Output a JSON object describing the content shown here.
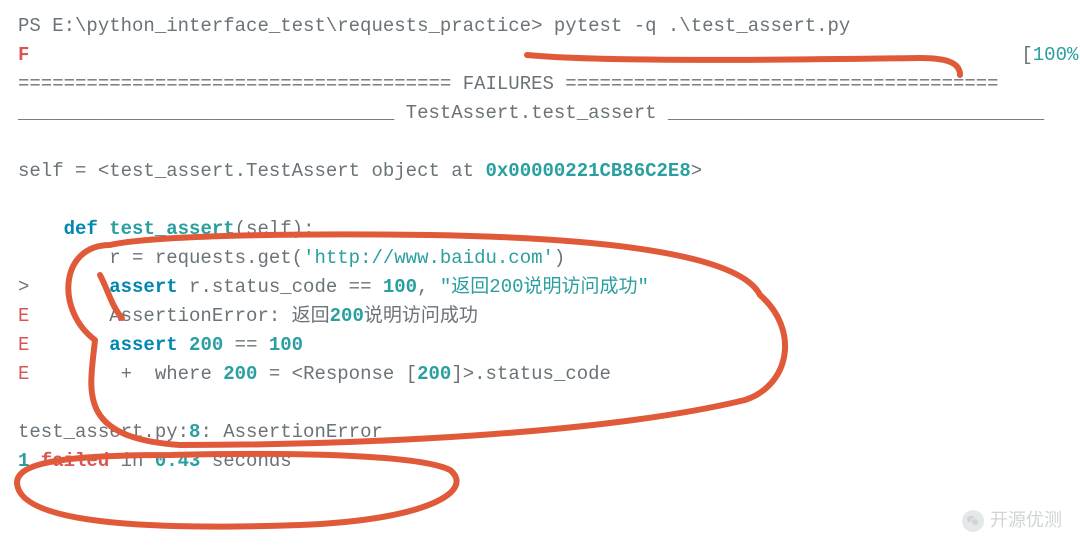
{
  "line1": {
    "prompt": "PS E:\\python_interface_test\\requests_practice> ",
    "cmd": "pytest -q .\\test_assert.py"
  },
  "line2": {
    "fail": "F",
    "pct_open": "[",
    "pct_val": "100%",
    "pct_close": "]"
  },
  "line3": {
    "eq_left": "====================================== ",
    "failures": "FAILURES",
    "eq_right": " ======================================"
  },
  "line4": {
    "u_left": "_________________________________ ",
    "tname": "TestAssert.test_assert",
    "u_right": " _________________________________"
  },
  "blank1": " ",
  "line5": {
    "pre": "self = <test_assert.TestAssert object at ",
    "hex": "0x00000221CB86C2E8",
    "post": ">"
  },
  "blank2": " ",
  "line6": {
    "indent": "    ",
    "def": "def",
    "sp": " ",
    "fn": "test_assert",
    "rest": "(self):"
  },
  "line7": {
    "indent": "        ",
    "text": "r = requests.get(",
    "url": "'http://www.baidu.com'",
    "close": ")"
  },
  "line8": {
    "mark": ">       ",
    "assert": "assert",
    "mid": " r.status_code == ",
    "num": "100",
    "comma": ", ",
    "msg": "\"返回200说明访问成功\""
  },
  "line9": {
    "mark": "E       ",
    "pre": "AssertionError: 返回",
    "num": "200",
    "post": "说明访问成功"
  },
  "line10": {
    "mark": "E       ",
    "assert": "assert",
    "sp": " ",
    "n1": "200",
    "eq": " == ",
    "n2": "100"
  },
  "line11": {
    "mark": "E        ",
    "plus": "+  where ",
    "n1": "200",
    "mid": " = <Response [",
    "n2": "200",
    "end": "]>.status_code"
  },
  "blank3": " ",
  "line12": {
    "pre": "test_assert.py:",
    "ln": "8",
    "post": ": AssertionError"
  },
  "line13": {
    "one": "1",
    "failed": " failed",
    "in": " in ",
    "sec": "0.43",
    "rest": " seconds"
  },
  "watermark": "开源优测",
  "annotation_color": "#e05a3a"
}
